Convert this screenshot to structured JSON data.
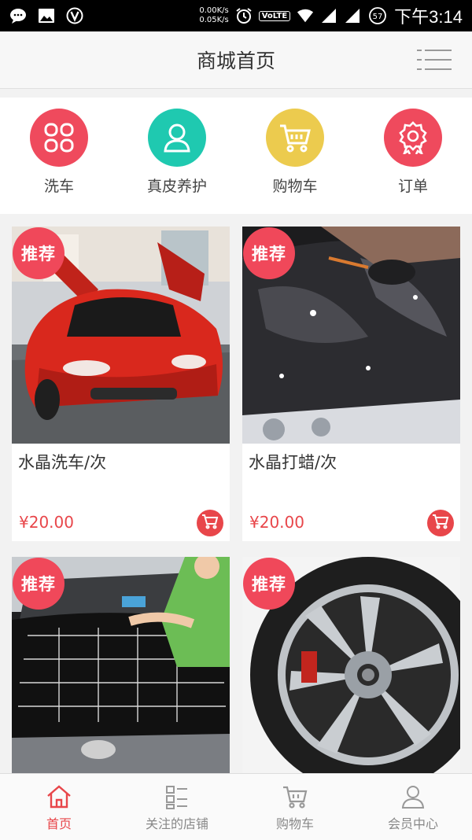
{
  "status_bar": {
    "net_up": "0.00K/s",
    "net_down": "0.05K/s",
    "volte": "VoLTE",
    "battery": "57",
    "time": "下午3:14"
  },
  "header": {
    "title": "商城首页"
  },
  "categories": [
    {
      "label": "洗车",
      "icon": "grid-icon",
      "color": "#ef4a5d"
    },
    {
      "label": "真皮养护",
      "icon": "user-icon",
      "color": "#1fc9b0"
    },
    {
      "label": "购物车",
      "icon": "cart-icon",
      "color": "#eccb4e"
    },
    {
      "label": "订单",
      "icon": "award-icon",
      "color": "#ef4a5d"
    }
  ],
  "products": [
    {
      "name": "水晶洗车/次",
      "price": "¥20.00",
      "badge": "推荐"
    },
    {
      "name": "水晶打蜡/次",
      "price": "¥20.00",
      "badge": "推荐"
    },
    {
      "badge": "推荐"
    },
    {
      "badge": "推荐"
    }
  ],
  "tabs": [
    {
      "label": "首页",
      "icon": "home-icon",
      "active": true
    },
    {
      "label": "关注的店铺",
      "icon": "store-list-icon"
    },
    {
      "label": "购物车",
      "icon": "cart-icon"
    },
    {
      "label": "会员中心",
      "icon": "user-icon"
    }
  ],
  "colors": {
    "accent": "#e8464a",
    "badge": "#f0485a"
  }
}
